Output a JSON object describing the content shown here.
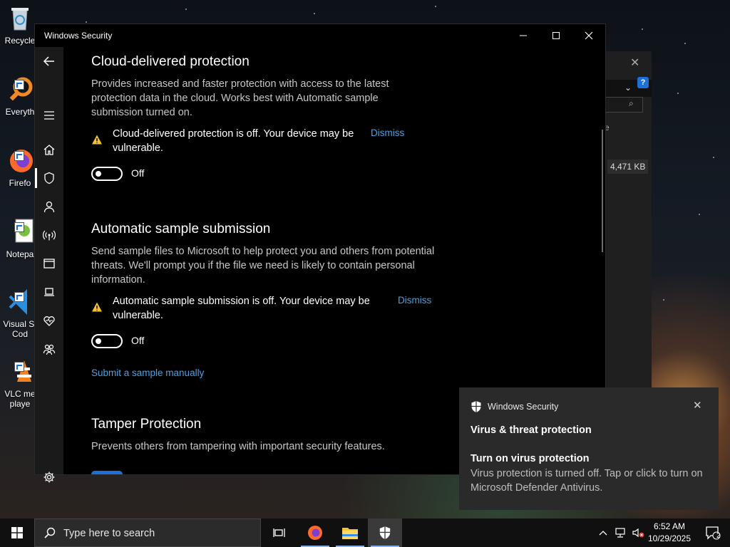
{
  "desktop": {
    "icons": [
      {
        "label": "Recycle",
        "icon": "recycle-bin-icon"
      },
      {
        "label": "Everyth",
        "icon": "everything-search-icon"
      },
      {
        "label": "Firefo",
        "icon": "firefox-icon"
      },
      {
        "label": "Notepa",
        "icon": "notepad-plus-plus-icon"
      },
      {
        "label": "Visual St Cod",
        "icon": "vscode-icon"
      },
      {
        "label": "VLC me playe",
        "icon": "vlc-icon"
      }
    ]
  },
  "background_window": {
    "size_text": "4,471 KB",
    "partial_text": "e"
  },
  "window": {
    "title": "Windows Security",
    "controls": {
      "minimize": "—",
      "maximize": "☐",
      "close": "✕"
    },
    "sidebar": {
      "items": [
        {
          "icon": "back-arrow-icon"
        },
        {
          "icon": "hamburger-menu-icon"
        },
        {
          "icon": "home-icon"
        },
        {
          "icon": "shield-icon",
          "selected": true
        },
        {
          "icon": "person-icon"
        },
        {
          "icon": "wireless-icon"
        },
        {
          "icon": "app-browser-icon"
        },
        {
          "icon": "laptop-icon"
        },
        {
          "icon": "health-heart-icon"
        },
        {
          "icon": "family-icon"
        },
        {
          "icon": "settings-gear-icon"
        }
      ]
    },
    "sections": {
      "cloud": {
        "title": "Cloud-delivered protection",
        "description": "Provides increased and faster protection with access to the latest protection data in the cloud. Works best with Automatic sample submission turned on.",
        "warning": "Cloud-delivered protection is off. Your device may be vulnerable.",
        "dismiss": "Dismiss",
        "toggle_label": "Off"
      },
      "sample": {
        "title": "Automatic sample submission",
        "description": "Send sample files to Microsoft to help protect you and others from potential threats. We'll prompt you if the file we need is likely to contain personal information.",
        "warning": "Automatic sample submission is off. Your device may be vulnerable.",
        "dismiss": "Dismiss",
        "toggle_label": "Off",
        "link": "Submit a sample manually"
      },
      "tamper": {
        "title": "Tamper Protection",
        "description": "Prevents others from tampering with important security features."
      }
    }
  },
  "toast": {
    "app_name": "Windows Security",
    "heading": "Virus & threat protection",
    "subheading": "Turn on virus protection",
    "body": "Virus protection is turned off. Tap or click to turn on Microsoft Defender Antivirus.",
    "close": "✕"
  },
  "taskbar": {
    "search_placeholder": "Type here to search",
    "time": "6:52 AM",
    "date": "10/29/2025",
    "notification_count": "2",
    "colors": {
      "accent": "#4aa0e6",
      "taskbar": "#101010"
    }
  }
}
